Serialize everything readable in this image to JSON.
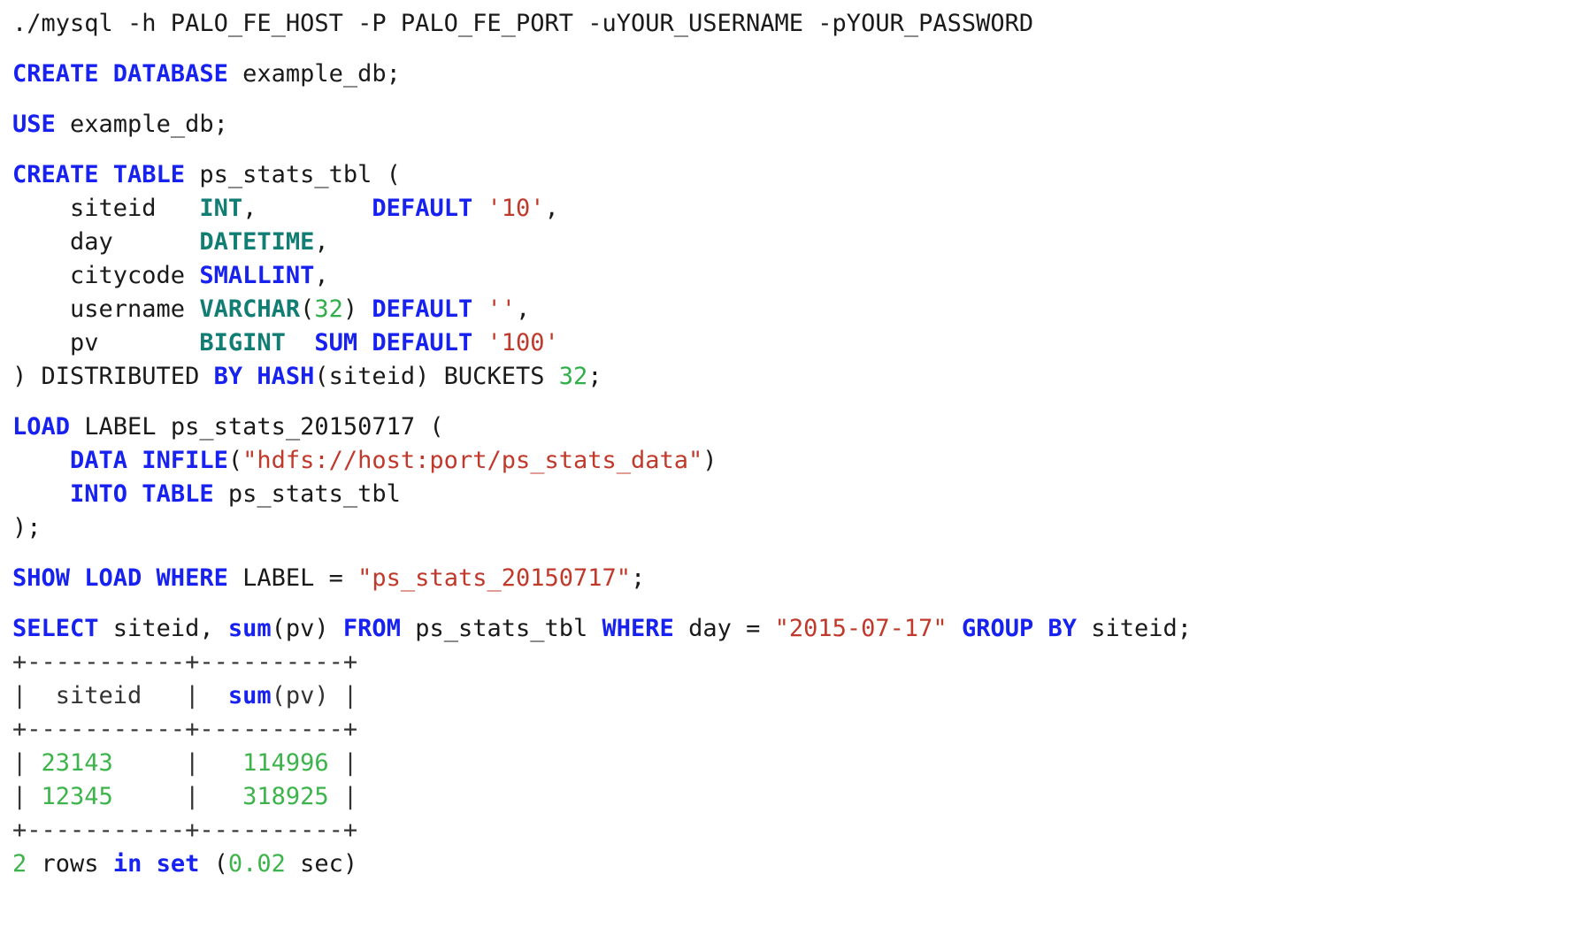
{
  "document": {
    "kind": "sql-code-listing",
    "background_color": "#ffffff",
    "colors": {
      "plain": "#1a1a1a",
      "keyword": "#1721f0",
      "datatype": "#127e73",
      "string": "#c0392b",
      "number": "#2fae4a",
      "result_value": "#3cb44b",
      "table_border": "#333333"
    }
  },
  "lines": [
    {
      "id": "line-shell-command",
      "tokens": [
        {
          "text": "./mysql -h PALO_FE_HOST -P PALO_FE_PORT -uYOUR_USERNAME -pYOUR_PASSWORD",
          "style": "plain"
        }
      ]
    },
    {
      "id": "blank-1",
      "blank": true,
      "tokens": []
    },
    {
      "id": "line-create-database",
      "tokens": [
        {
          "text": "CREATE DATABASE",
          "style": "keyword"
        },
        {
          "text": " example_db;",
          "style": "plain"
        }
      ]
    },
    {
      "id": "blank-2",
      "blank": true,
      "tokens": []
    },
    {
      "id": "line-use-database",
      "tokens": [
        {
          "text": "USE",
          "style": "keyword"
        },
        {
          "text": " example_db;",
          "style": "plain"
        }
      ]
    },
    {
      "id": "blank-3",
      "blank": true,
      "tokens": []
    },
    {
      "id": "line-create-table",
      "tokens": [
        {
          "text": "CREATE TABLE",
          "style": "keyword"
        },
        {
          "text": " ps_stats_tbl (",
          "style": "plain"
        }
      ]
    },
    {
      "id": "line-column-siteid",
      "tokens": [
        {
          "text": "    siteid   ",
          "style": "plain"
        },
        {
          "text": "INT",
          "style": "datatype"
        },
        {
          "text": ",        ",
          "style": "plain"
        },
        {
          "text": "DEFAULT",
          "style": "keyword"
        },
        {
          "text": " ",
          "style": "plain"
        },
        {
          "text": "'10'",
          "style": "string"
        },
        {
          "text": ",",
          "style": "plain"
        }
      ]
    },
    {
      "id": "line-column-day",
      "tokens": [
        {
          "text": "    day      ",
          "style": "plain"
        },
        {
          "text": "DATETIME",
          "style": "datatype"
        },
        {
          "text": ",",
          "style": "plain"
        }
      ]
    },
    {
      "id": "line-column-citycode",
      "tokens": [
        {
          "text": "    citycode ",
          "style": "plain"
        },
        {
          "text": "SMALLINT",
          "style": "keyword"
        },
        {
          "text": ",",
          "style": "plain"
        }
      ]
    },
    {
      "id": "line-column-username",
      "tokens": [
        {
          "text": "    username ",
          "style": "plain"
        },
        {
          "text": "VARCHAR",
          "style": "datatype"
        },
        {
          "text": "(",
          "style": "plain"
        },
        {
          "text": "32",
          "style": "number"
        },
        {
          "text": ") ",
          "style": "plain"
        },
        {
          "text": "DEFAULT",
          "style": "keyword"
        },
        {
          "text": " ",
          "style": "plain"
        },
        {
          "text": "''",
          "style": "string"
        },
        {
          "text": ",",
          "style": "plain"
        }
      ]
    },
    {
      "id": "line-column-pv",
      "tokens": [
        {
          "text": "    pv       ",
          "style": "plain"
        },
        {
          "text": "BIGINT",
          "style": "datatype"
        },
        {
          "text": "  ",
          "style": "plain"
        },
        {
          "text": "SUM DEFAULT",
          "style": "keyword"
        },
        {
          "text": " ",
          "style": "plain"
        },
        {
          "text": "'100'",
          "style": "string"
        }
      ]
    },
    {
      "id": "line-distributed-by",
      "tokens": [
        {
          "text": ") DISTRIBUTED ",
          "style": "plain"
        },
        {
          "text": "BY HASH",
          "style": "keyword"
        },
        {
          "text": "(siteid) BUCKETS ",
          "style": "plain"
        },
        {
          "text": "32",
          "style": "number"
        },
        {
          "text": ";",
          "style": "plain"
        }
      ]
    },
    {
      "id": "blank-4",
      "blank": true,
      "tokens": []
    },
    {
      "id": "line-load-label",
      "tokens": [
        {
          "text": "LOAD",
          "style": "keyword"
        },
        {
          "text": " LABEL ps_stats_20150717 (",
          "style": "plain"
        }
      ]
    },
    {
      "id": "line-data-infile",
      "tokens": [
        {
          "text": "    ",
          "style": "plain"
        },
        {
          "text": "DATA INFILE",
          "style": "keyword"
        },
        {
          "text": "(",
          "style": "plain"
        },
        {
          "text": "\"hdfs://host:port/ps_stats_data\"",
          "style": "string"
        },
        {
          "text": ")",
          "style": "plain"
        }
      ]
    },
    {
      "id": "line-into-table",
      "tokens": [
        {
          "text": "    ",
          "style": "plain"
        },
        {
          "text": "INTO TABLE",
          "style": "keyword"
        },
        {
          "text": " ps_stats_tbl",
          "style": "plain"
        }
      ]
    },
    {
      "id": "line-load-close",
      "tokens": [
        {
          "text": ");",
          "style": "plain"
        }
      ]
    },
    {
      "id": "blank-5",
      "blank": true,
      "tokens": []
    },
    {
      "id": "line-show-load",
      "tokens": [
        {
          "text": "SHOW LOAD WHERE",
          "style": "keyword"
        },
        {
          "text": " LABEL = ",
          "style": "plain"
        },
        {
          "text": "\"ps_stats_20150717\"",
          "style": "string"
        },
        {
          "text": ";",
          "style": "plain"
        }
      ]
    },
    {
      "id": "blank-6",
      "blank": true,
      "tokens": []
    },
    {
      "id": "line-select-query",
      "tokens": [
        {
          "text": "SELECT",
          "style": "keyword"
        },
        {
          "text": " siteid, ",
          "style": "plain"
        },
        {
          "text": "sum",
          "style": "keyword"
        },
        {
          "text": "(pv) ",
          "style": "plain"
        },
        {
          "text": "FROM",
          "style": "keyword"
        },
        {
          "text": " ps_stats_tbl ",
          "style": "plain"
        },
        {
          "text": "WHERE",
          "style": "keyword"
        },
        {
          "text": " day = ",
          "style": "plain"
        },
        {
          "text": "\"2015-07-17\"",
          "style": "string"
        },
        {
          "text": " ",
          "style": "plain"
        },
        {
          "text": "GROUP BY",
          "style": "keyword"
        },
        {
          "text": " siteid;",
          "style": "plain"
        }
      ]
    },
    {
      "id": "line-result-border-top",
      "result": true,
      "tokens": [
        {
          "text": "+-----------+----------+",
          "style": "border"
        }
      ]
    },
    {
      "id": "line-result-header",
      "result": true,
      "tokens": [
        {
          "text": "|  siteid   |  ",
          "style": "border"
        },
        {
          "text": "sum",
          "style": "keyword"
        },
        {
          "text": "(pv) |",
          "style": "border"
        }
      ]
    },
    {
      "id": "line-result-border-mid",
      "result": true,
      "tokens": [
        {
          "text": "+-----------+----------+",
          "style": "border"
        }
      ]
    },
    {
      "id": "line-result-row-1",
      "result": true,
      "tokens": [
        {
          "text": "| ",
          "style": "border"
        },
        {
          "text": "23143",
          "style": "result_value"
        },
        {
          "text": "     |   ",
          "style": "border"
        },
        {
          "text": "114996",
          "style": "result_value"
        },
        {
          "text": " |",
          "style": "border"
        }
      ]
    },
    {
      "id": "line-result-row-2",
      "result": true,
      "tokens": [
        {
          "text": "| ",
          "style": "border"
        },
        {
          "text": "12345",
          "style": "result_value"
        },
        {
          "text": "     |   ",
          "style": "border"
        },
        {
          "text": "318925",
          "style": "result_value"
        },
        {
          "text": " |",
          "style": "border"
        }
      ]
    },
    {
      "id": "line-result-border-bottom",
      "result": true,
      "tokens": [
        {
          "text": "+-----------+----------+",
          "style": "border"
        }
      ]
    },
    {
      "id": "line-result-status",
      "result": true,
      "tokens": [
        {
          "text": "2",
          "style": "result_value"
        },
        {
          "text": " rows ",
          "style": "plain"
        },
        {
          "text": "in set",
          "style": "keyword"
        },
        {
          "text": " (",
          "style": "plain"
        },
        {
          "text": "0.02",
          "style": "result_value"
        },
        {
          "text": " sec)",
          "style": "plain"
        }
      ]
    }
  ],
  "result_table": {
    "columns": [
      "siteid",
      "sum(pv)"
    ],
    "rows": [
      [
        "23143",
        "114996"
      ],
      [
        "12345",
        "318925"
      ]
    ],
    "row_count": 2,
    "elapsed_seconds": "0.02",
    "status_text": "2 rows in set (0.02 sec)"
  }
}
